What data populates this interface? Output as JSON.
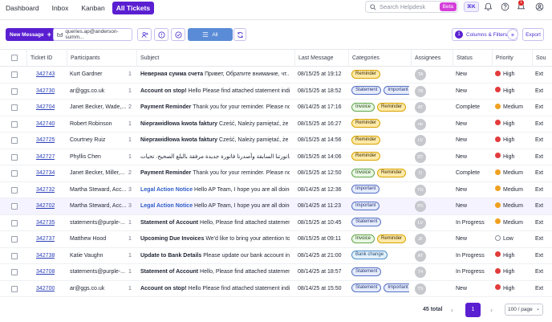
{
  "nav": {
    "links": [
      "Dashboard",
      "Inbox",
      "Kanban"
    ],
    "active": "All Tickets",
    "search_placeholder": "Search Helpdesk",
    "beta": "Beta",
    "shortcut": "⌘K",
    "notif_count": "1"
  },
  "toolbar": {
    "new_message": "New Message",
    "mailbox": "queries.ap@anderson-summ...",
    "all_label": "All",
    "filter_count": "1",
    "columns_filters": "Columns & Filters",
    "export": "Export"
  },
  "columns": [
    "Ticket ID",
    "Participants",
    "Subject",
    "Last Message",
    "Categories",
    "Assignees",
    "Status",
    "Priority",
    "Sou"
  ],
  "rows": [
    {
      "id": "342743",
      "part": "Kurt Gardner",
      "count": "1",
      "subj_b": "Неверная сумма счета",
      "subj": "Привет, Обратите внимание, чт...",
      "legal": false,
      "last": "08/15/25 at 19:12",
      "cats": [
        [
          "Reminder",
          "rem"
        ]
      ],
      "av": "TA",
      "status": "New",
      "prio": "High",
      "src": "Ext"
    },
    {
      "id": "342730",
      "part": "ar@ggs.co.uk",
      "count": "1",
      "subj_b": "Account on stop!",
      "subj": "Hello Please find attached statement indi...",
      "legal": false,
      "last": "08/15/25 at 18:52",
      "cats": [
        [
          "Statement",
          "stm"
        ],
        [
          "Important",
          "imp"
        ]
      ],
      "av": "TB",
      "status": "New",
      "prio": "High",
      "src": "Ext"
    },
    {
      "id": "342704",
      "part": "Janet Becker, Wade,...",
      "count": "2",
      "subj_b": "Payment Reminder",
      "subj": "Thank you for your reminder. Please not...",
      "legal": false,
      "last": "08/14/25 at 17:16",
      "cats": [
        [
          "Invoice",
          "inv"
        ],
        [
          "Reminder",
          "rem"
        ]
      ],
      "av": "AT",
      "status": "Complete",
      "prio": "Medium",
      "src": "Ext"
    },
    {
      "id": "342740",
      "part": "Robert Robinson",
      "count": "1",
      "subj_b": "Nieprawidłowa kwota faktury",
      "subj": "Cześć, Należy pamiętać, że p...",
      "legal": false,
      "last": "08/15/25 at 16:27",
      "cats": [
        [
          "Reminder",
          "rem"
        ]
      ],
      "av": "ne",
      "status": "New",
      "prio": "High",
      "src": "Ext"
    },
    {
      "id": "342725",
      "part": "Courtney Ruiz",
      "count": "1",
      "subj_b": "Nieprawidłowa kwota faktury",
      "subj": "Cześć, Należy pamiętać, że p...",
      "legal": false,
      "last": "08/15/25 at 14:56",
      "cats": [
        [
          "Reminder",
          "rem"
        ]
      ],
      "av": "LV",
      "status": "New",
      "prio": "High",
      "src": "Ext"
    },
    {
      "id": "342727",
      "part": "Phyllis Chen",
      "count": "1",
      "subj_b": "",
      "subj": "خطأ في فاتورتنا السابقة وأصدرنا فاتورة جديدة مرفقة بالبلغ الصحيح. تحيات...",
      "legal": false,
      "last": "08/15/25 at 14:06",
      "cats": [
        [
          "Reminder",
          "rem"
        ]
      ],
      "av": "DT",
      "status": "New",
      "prio": "High",
      "src": "Ext"
    },
    {
      "id": "342734",
      "part": "Janet Becker, Miller,...",
      "count": "2",
      "subj_b": "Payment Reminder",
      "subj": "Thank you for your reminder. Please not...",
      "legal": false,
      "last": "08/15/25 at 12:50",
      "cats": [
        [
          "Invoice",
          "inv"
        ],
        [
          "Reminder",
          "rem"
        ]
      ],
      "av": "Ŋ",
      "status": "Complete",
      "prio": "Medium",
      "src": "Ext"
    },
    {
      "id": "342732",
      "part": "Martha Steward, Acc...",
      "count": "3",
      "subj_b": "Legal Action Notice",
      "subj": "Hello AP Team, I hope you are all doing ...",
      "legal": true,
      "last": "08/14/25 at 12:36",
      "cats": [
        [
          "Important",
          "imp"
        ]
      ],
      "av": "TG",
      "status": "New",
      "prio": "Medium",
      "src": "Ext"
    },
    {
      "id": "342702",
      "part": "Martha Steward, Acc...",
      "count": "3",
      "subj_b": "Legal Action Notice",
      "subj": "Hello AP Team, I hope you are all doing ...",
      "legal": true,
      "last": "08/14/25 at 11:23",
      "cats": [
        [
          "Important",
          "imp"
        ]
      ],
      "av": "PS",
      "status": "New",
      "prio": "Medium",
      "src": "Ext"
    },
    {
      "id": "342735",
      "part": "statements@purple-...",
      "count": "1",
      "subj_b": "Statement of Account",
      "subj": "Hello, Please find attached statemen...",
      "legal": false,
      "last": "08/15/25 at 10:45",
      "cats": [
        [
          "Statement",
          "stm"
        ]
      ],
      "av": "LV",
      "status": "In Progress",
      "prio": "Medium",
      "src": "Ext"
    },
    {
      "id": "342737",
      "part": "Matthew Hood",
      "count": "1",
      "subj_b": "Upcoming Due Invoices",
      "subj": "We'd like to bring your attention to t...",
      "legal": false,
      "last": "08/15/25 at 09:11",
      "cats": [
        [
          "Invoice",
          "inv"
        ],
        [
          "Reminder",
          "rem"
        ]
      ],
      "av": "JF",
      "status": "New",
      "prio": "Low",
      "src": "Ext"
    },
    {
      "id": "342738",
      "part": "Katie Vaughn",
      "count": "1",
      "subj_b": "Update to Bank Details",
      "subj": "Please update our bank account info...",
      "legal": false,
      "last": "08/14/25 at 21:00",
      "cats": [
        [
          "Bank change",
          "bank"
        ]
      ],
      "av": "AT",
      "status": "In Progress",
      "prio": "High",
      "src": "Ext"
    },
    {
      "id": "342708",
      "part": "statements@purple-...",
      "count": "1",
      "subj_b": "Statement of Account",
      "subj": "Hello, Please find attached statemen...",
      "legal": false,
      "last": "08/14/25 at 18:57",
      "cats": [
        [
          "Statement",
          "stm"
        ]
      ],
      "av": "T4",
      "status": "In Progress",
      "prio": "High",
      "src": "Ext"
    },
    {
      "id": "342700",
      "part": "ar@ggs.co.uk",
      "count": "1",
      "subj_b": "Account on stop!",
      "subj": "Hello Please find attached statement indi...",
      "legal": false,
      "last": "08/14/25 at 15:50",
      "cats": [
        [
          "Statement",
          "stm"
        ],
        [
          "Important",
          "imp"
        ]
      ],
      "av": "TS",
      "status": "New",
      "prio": "High",
      "src": "Ext"
    }
  ],
  "pagination": {
    "total": "45 total",
    "page": "1",
    "per_page": "100 / page"
  },
  "colors": {
    "accent": "#5a1fd1",
    "link": "#2a3fb8",
    "high": "#e23b3b",
    "medium": "#f0a020"
  }
}
